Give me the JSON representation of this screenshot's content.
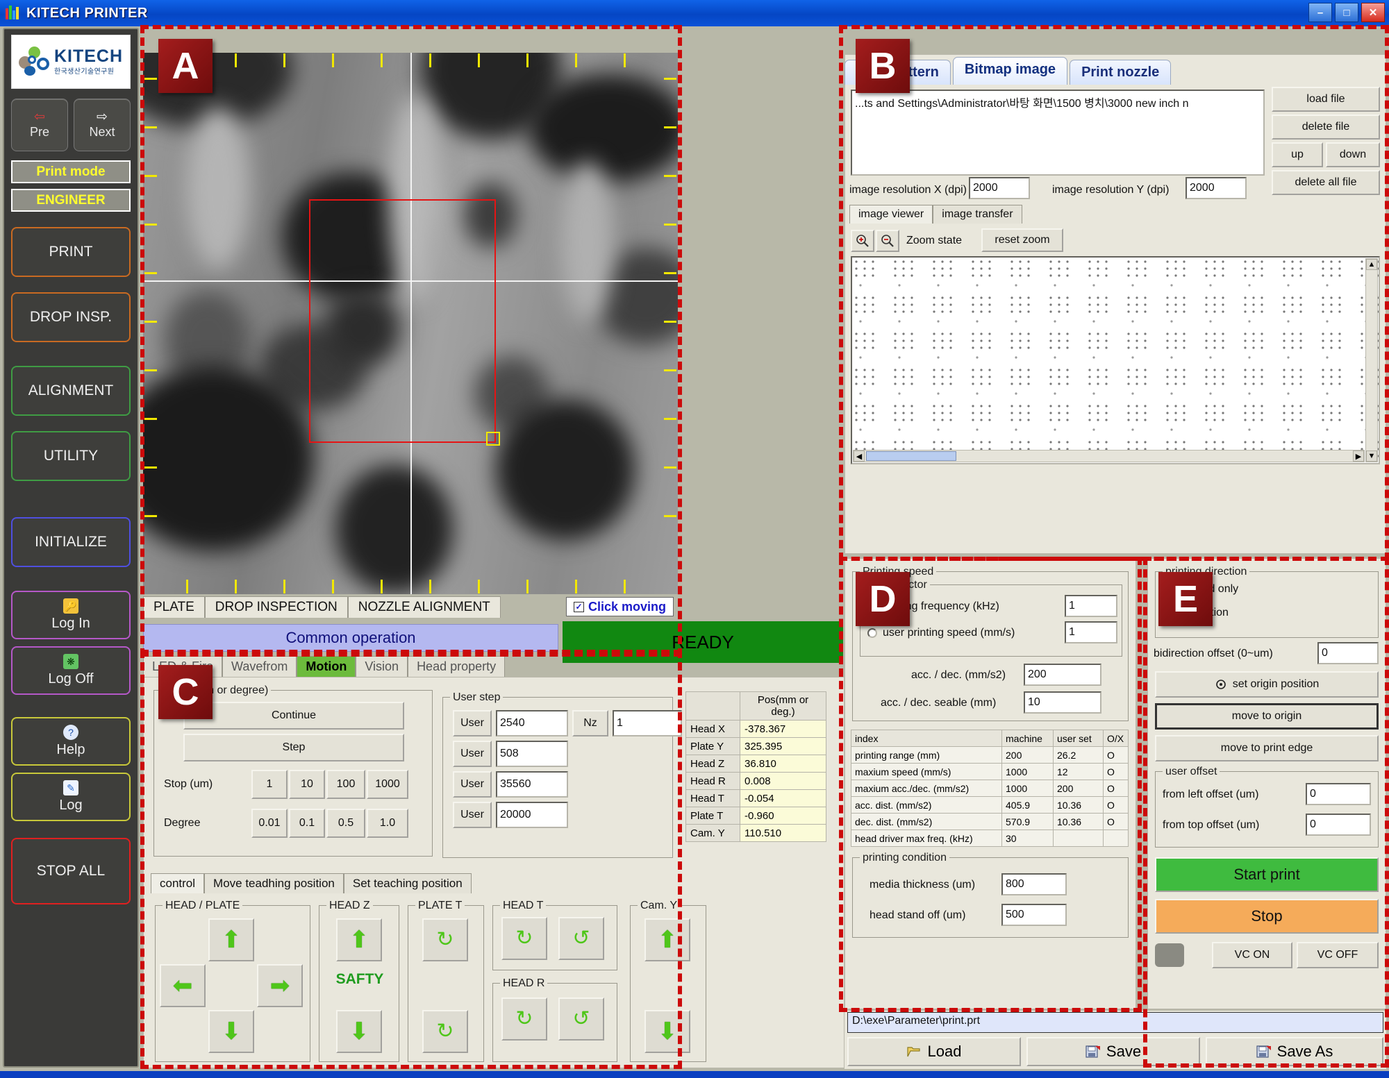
{
  "window": {
    "title": "KITECH PRINTER",
    "minimize": "–",
    "maximize": "□",
    "close": "✕"
  },
  "sidebar": {
    "logo": {
      "name": "KITECH",
      "subtitle": "한국생산기술연구원"
    },
    "nav": [
      {
        "label": "Pre",
        "icon": "left-arrow-icon"
      },
      {
        "label": "Next",
        "icon": "right-arrow-icon"
      }
    ],
    "chips": [
      "Print mode",
      "ENGINEER"
    ],
    "buttons": [
      {
        "label": "PRINT",
        "color": "orange"
      },
      {
        "label": "DROP INSP.",
        "color": "orange"
      },
      {
        "label": "ALIGNMENT",
        "color": "green"
      },
      {
        "label": "UTILITY",
        "color": "green"
      },
      {
        "label": "INITIALIZE",
        "color": "blue"
      },
      {
        "label": "Log In",
        "color": "purple",
        "icon": "key-icon"
      },
      {
        "label": "Log Off",
        "color": "purple",
        "icon": "logoff-icon"
      },
      {
        "label": "Help",
        "color": "yellow",
        "icon": "question-icon"
      },
      {
        "label": "Log",
        "color": "yellow",
        "icon": "note-icon"
      },
      {
        "label": "STOP ALL",
        "color": "red"
      }
    ]
  },
  "badges": {
    "a": "A",
    "b": "B",
    "c": "C",
    "d": "D",
    "e": "E"
  },
  "camera": {
    "tabs": [
      "PLATE",
      "DROP INSPECTION",
      "NOZZLE ALIGNMENT"
    ],
    "click_moving_label": "Click moving",
    "click_moving_checked": true,
    "common_operation": "Common operation",
    "status": "READY",
    "status_color": "#118811"
  },
  "motion": {
    "tabs": [
      {
        "label": "LED & Fire",
        "active": false
      },
      {
        "label": "Wavefrom",
        "active": false
      },
      {
        "label": "Motion",
        "active": true
      },
      {
        "label": "Vision",
        "active": false
      },
      {
        "label": "Head property",
        "active": false
      }
    ],
    "mode_group_label": "mode (um or degree)",
    "continue_label": "Continue",
    "step_label": "Step",
    "stop_label": "Stop (um)",
    "stop_values": [
      "1",
      "10",
      "100",
      "1000"
    ],
    "degree_label": "Degree",
    "degree_values": [
      "0.01",
      "0.1",
      "0.5",
      "1.0"
    ],
    "user_step_label": "User step",
    "user_steps": [
      {
        "button": "User",
        "value": "2540"
      },
      {
        "button": "User",
        "value": "508"
      },
      {
        "button": "User",
        "value": "35560"
      },
      {
        "button": "User",
        "value": "20000"
      }
    ],
    "nz_label": "Nz",
    "nz_value": "1",
    "pos_header": "Pos(mm or deg.)",
    "positions": [
      {
        "axis": "Head X",
        "value": "-378.367"
      },
      {
        "axis": "Plate Y",
        "value": "325.395"
      },
      {
        "axis": "Head Z",
        "value": "36.810"
      },
      {
        "axis": "Head R",
        "value": "0.008"
      },
      {
        "axis": "Head T",
        "value": "-0.054"
      },
      {
        "axis": "Plate T",
        "value": "-0.960"
      },
      {
        "axis": "Cam. Y",
        "value": "110.510"
      }
    ],
    "lower_tabs": [
      {
        "label": "control",
        "active": true
      },
      {
        "label": "Move teadhing position",
        "active": false
      },
      {
        "label": "Set teaching position",
        "active": false
      }
    ],
    "jog_groups": [
      "HEAD / PLATE",
      "HEAD Z",
      "PLATE T",
      "HEAD T",
      "Cam. Y",
      "HEAD R"
    ],
    "safty_label": "SAFTY"
  },
  "bitmap": {
    "tabs": [
      {
        "label": "Print pattern",
        "active": false
      },
      {
        "label": "Bitmap image",
        "active": true
      },
      {
        "label": "Print nozzle",
        "active": false
      }
    ],
    "file_path": "...ts and Settings\\Administrator\\바탕 화면\\1500 병치\\3000 new inch n",
    "file_buttons": [
      "load file",
      "delete file",
      "up",
      "down",
      "delete all file"
    ],
    "res_x_label": "image resolution X (dpi)",
    "res_x_value": "2000",
    "res_y_label": "image resolution Y (dpi)",
    "res_y_value": "2000",
    "viewer_tabs": [
      {
        "label": "image viewer",
        "active": true
      },
      {
        "label": "image transfer",
        "active": false
      }
    ],
    "zoom_in_icon": "zoom-in-icon",
    "zoom_out_icon": "zoom-out-icon",
    "zoom_state_label": "Zoom state",
    "reset_zoom_label": "reset zoom"
  },
  "speed": {
    "group_label": "Printing speed",
    "sub_group_label": "scale factor",
    "freq_label": "printing frequency (kHz)",
    "freq_value": "1",
    "user_speed_label": "user printing speed (mm/s)",
    "user_speed_value": "1",
    "accdec_label": "acc. / dec. (mm/s2)",
    "accdec_value": "200",
    "accdec_seable_label": "acc. / dec. seable (mm)",
    "accdec_seable_value": "10",
    "table_headers": [
      "index",
      "machine",
      "user set",
      "O/X"
    ],
    "table_rows": [
      {
        "index": "printing range (mm)",
        "machine": "200",
        "user_set": "26.2",
        "ox": "O"
      },
      {
        "index": "maxium speed (mm/s)",
        "machine": "1000",
        "user_set": "12",
        "ox": "O"
      },
      {
        "index": "maxium acc./dec. (mm/s2)",
        "machine": "1000",
        "user_set": "200",
        "ox": "O"
      },
      {
        "index": "acc. dist. (mm/s2)",
        "machine": "405.9",
        "user_set": "10.36",
        "ox": "O"
      },
      {
        "index": "dec. dist. (mm/s2)",
        "machine": "570.9",
        "user_set": "10.36",
        "ox": "O"
      },
      {
        "index": "head driver max freq. (kHz)",
        "machine": "30",
        "user_set": "",
        "ox": ""
      }
    ],
    "condition_label": "printing condition",
    "media_thickness_label": "media thickness (um)",
    "media_thickness_value": "800",
    "head_stand_off_label": "head stand off (um)",
    "head_stand_off_value": "500"
  },
  "direction": {
    "group_label": "printing direction",
    "option_forward": "forward only",
    "option_bidirection": "bidirection",
    "bidir_offset_label": "bidirection offset (0~um)",
    "bidir_offset_value": "0",
    "set_origin_label": "set origin position",
    "set_origin_icon": "target-icon",
    "move_origin_label": "move to origin",
    "move_print_edge_label": "move to print edge",
    "user_offset_label": "user offset",
    "left_offset_label": "from left offset (um)",
    "left_offset_value": "0",
    "top_offset_label": "from top offset (um)",
    "top_offset_value": "0",
    "start_print_label": "Start print",
    "start_print_color": "#3fbb3f",
    "stop_label": "Stop",
    "stop_color": "#f5ab5a",
    "vc_on_label": "VC ON",
    "vc_off_label": "VC OFF"
  },
  "footer": {
    "path": "D:\\exe\\Parameter\\print.prt",
    "load_label": "Load",
    "save_label": "Save",
    "save_as_label": "Save As",
    "load_icon": "folder-open-icon",
    "save_icon": "floppy-icon"
  }
}
